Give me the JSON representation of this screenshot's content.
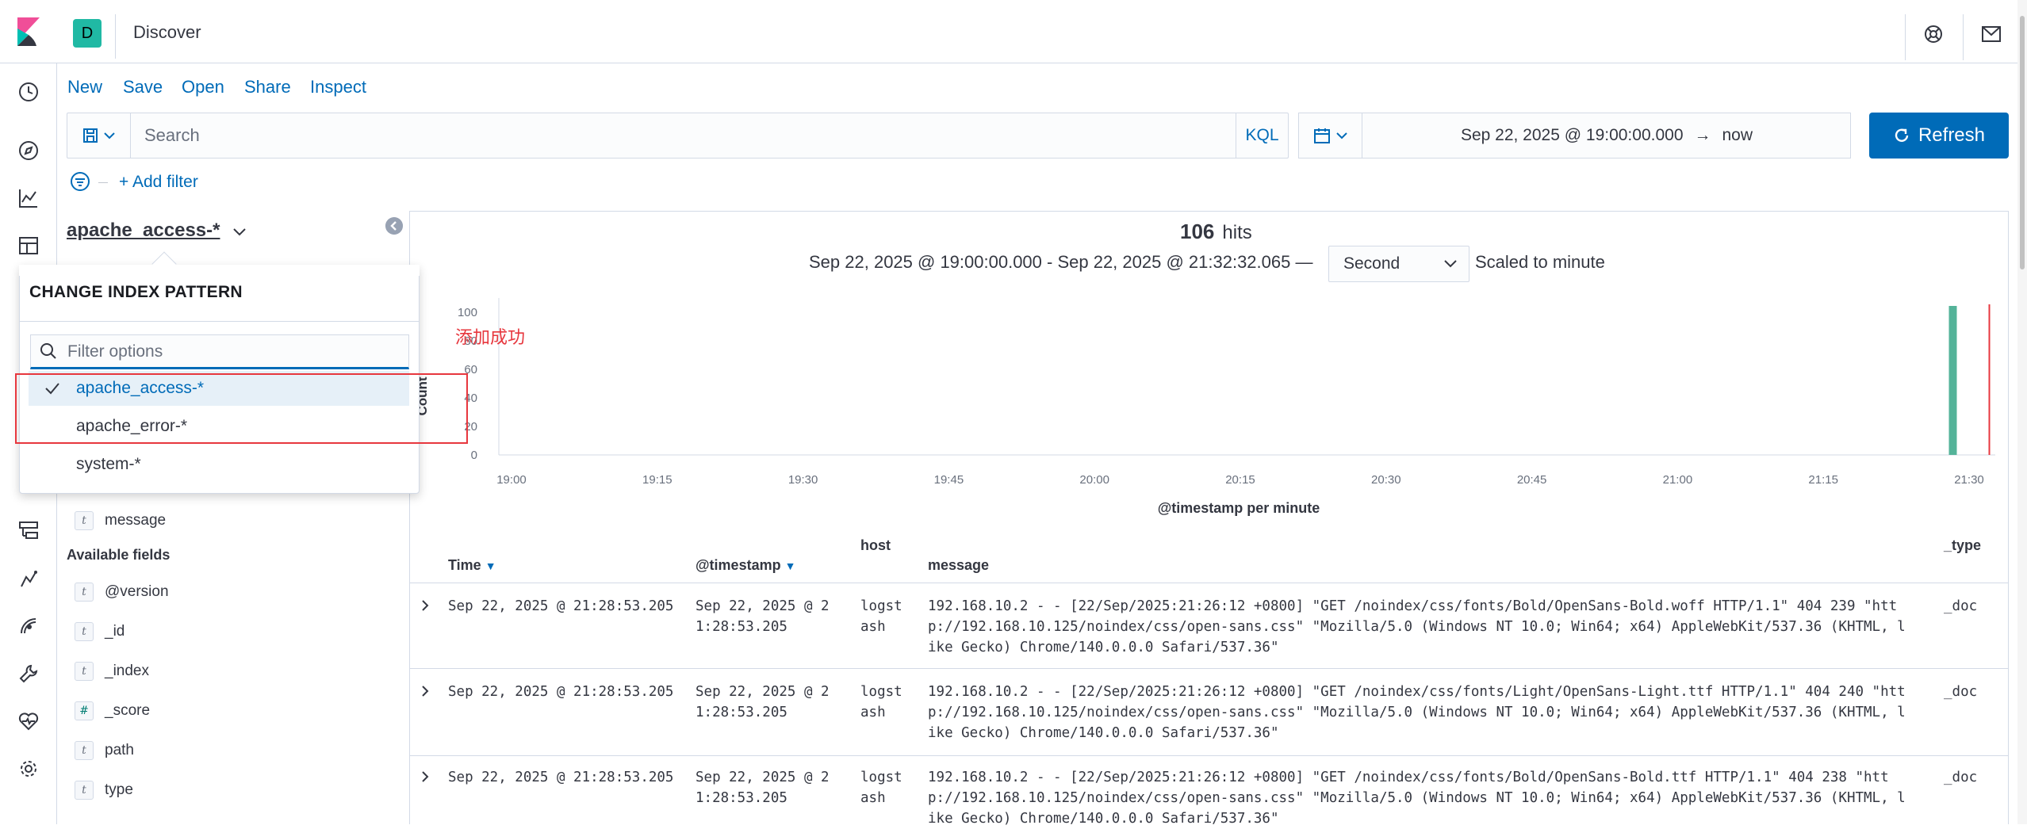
{
  "header": {
    "space_initial": "D",
    "app_title": "Discover"
  },
  "menu": {
    "new": "New",
    "save": "Save",
    "open": "Open",
    "share": "Share",
    "inspect": "Inspect"
  },
  "query": {
    "placeholder": "Search",
    "language": "KQL"
  },
  "time": {
    "start": "Sep 22, 2025 @ 19:00:00.000",
    "arrow": "→",
    "end": "now",
    "refresh_label": "Refresh"
  },
  "filter": {
    "add_label": "+ Add filter"
  },
  "sidebar": {
    "index_pattern": "apache_access-*",
    "selected_fields": [
      {
        "type": "t",
        "name": "message"
      }
    ],
    "available_title": "Available fields",
    "available_fields": [
      {
        "type": "t",
        "name": "@version"
      },
      {
        "type": "t",
        "name": "_id"
      },
      {
        "type": "t",
        "name": "_index"
      },
      {
        "type": "#",
        "name": "_score"
      },
      {
        "type": "t",
        "name": "path"
      },
      {
        "type": "t",
        "name": "type"
      }
    ]
  },
  "popover": {
    "title": "CHANGE INDEX PATTERN",
    "filter_placeholder": "Filter options",
    "options": [
      {
        "label": "apache_access-*",
        "selected": true
      },
      {
        "label": "apache_error-*",
        "selected": false
      },
      {
        "label": "system-*",
        "selected": false
      }
    ]
  },
  "annotation": "添加成功",
  "hits": {
    "count": "106",
    "label": "hits"
  },
  "range": {
    "text": "Sep 22, 2025 @ 19:00:00.000 - Sep 22, 2025 @ 21:32:32.065 —",
    "interval": "Second",
    "scaled": "Scaled to minute"
  },
  "chart_data": {
    "type": "bar",
    "ylabel": "Count",
    "xlabel": "@timestamp per minute",
    "ylim": [
      0,
      100
    ],
    "yticks": [
      0,
      20,
      40,
      60,
      80,
      100
    ],
    "xticks": [
      "19:00",
      "19:15",
      "19:30",
      "19:45",
      "20:00",
      "20:15",
      "20:30",
      "20:45",
      "21:00",
      "21:15",
      "21:30"
    ],
    "bars": [
      {
        "x": "21:28",
        "value": 106
      }
    ],
    "now_marker": "21:32",
    "bar_color": "#54b399",
    "marker_color": "#e7373e"
  },
  "table": {
    "columns": [
      "Time",
      "@timestamp",
      "host",
      "message",
      "_type"
    ],
    "rows": [
      {
        "time": "Sep 22, 2025 @ 21:28:53.205",
        "ts1": "Sep 22, 2025 @ 2",
        "ts2": "1:28:53.205",
        "host1": "logst",
        "host2": "ash",
        "msg1": "192.168.10.2 - - [22/Sep/2025:21:26:12 +0800] \"GET /noindex/css/fonts/Bold/OpenSans-Bold.woff HTTP/1.1\" 404 239 \"htt",
        "msg2": "p://192.168.10.125/noindex/css/open-sans.css\" \"Mozilla/5.0 (Windows NT 10.0; Win64; x64) AppleWebKit/537.36 (KHTML, l",
        "msg3": "ike Gecko) Chrome/140.0.0.0 Safari/537.36\"",
        "type": "_doc"
      },
      {
        "time": "Sep 22, 2025 @ 21:28:53.205",
        "ts1": "Sep 22, 2025 @ 2",
        "ts2": "1:28:53.205",
        "host1": "logst",
        "host2": "ash",
        "msg1": "192.168.10.2 - - [22/Sep/2025:21:26:12 +0800] \"GET /noindex/css/fonts/Light/OpenSans-Light.ttf HTTP/1.1\" 404 240 \"htt",
        "msg2": "p://192.168.10.125/noindex/css/open-sans.css\" \"Mozilla/5.0 (Windows NT 10.0; Win64; x64) AppleWebKit/537.36 (KHTML, l",
        "msg3": "ike Gecko) Chrome/140.0.0.0 Safari/537.36\"",
        "type": "_doc"
      },
      {
        "time": "Sep 22, 2025 @ 21:28:53.205",
        "ts1": "Sep 22, 2025 @ 2",
        "ts2": "1:28:53.205",
        "host1": "logst",
        "host2": "ash",
        "msg1": "192.168.10.2 - - [22/Sep/2025:21:26:12 +0800] \"GET /noindex/css/fonts/Bold/OpenSans-Bold.ttf HTTP/1.1\" 404 238 \"htt",
        "msg2": "p://192.168.10.125/noindex/css/open-sans.css\" \"Mozilla/5.0 (Windows NT 10.0; Win64; x64) AppleWebKit/537.36 (KHTML, l",
        "msg3": "ike Gecko) Chrome/140.0.0.0 Safari/537.36\"",
        "type": "_doc"
      }
    ]
  }
}
